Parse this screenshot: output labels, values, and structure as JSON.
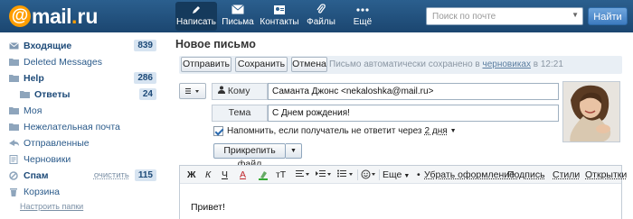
{
  "header": {
    "logo": {
      "at": "@",
      "mail": "mail",
      "dot": ".",
      "ru": "ru"
    },
    "nav": [
      {
        "label": "Написать",
        "icon": "pen-icon",
        "active": true
      },
      {
        "label": "Письма",
        "icon": "envelope-icon",
        "active": false
      },
      {
        "label": "Контакты",
        "icon": "contacts-icon",
        "active": false
      },
      {
        "label": "Файлы",
        "icon": "paperclip-icon",
        "active": false
      },
      {
        "label": "Ещё",
        "icon": "more-dots-icon",
        "active": false
      }
    ],
    "search": {
      "placeholder": "Поиск по почте"
    },
    "find_label": "Найти"
  },
  "sidebar": {
    "folders": [
      {
        "name": "Входящие",
        "icon": "envelope-icon",
        "count": "839",
        "bold": true
      },
      {
        "name": "Deleted Messages",
        "icon": "folder-icon",
        "count": "",
        "bold": false
      },
      {
        "name": "Help",
        "icon": "folder-icon",
        "count": "286",
        "bold": true
      },
      {
        "name": "Ответы",
        "icon": "folder-icon",
        "count": "24",
        "bold": true
      },
      {
        "name": "Моя",
        "icon": "folder-icon",
        "count": "",
        "bold": false
      },
      {
        "name": "Нежелательная почта",
        "icon": "folder-icon",
        "count": "",
        "bold": false
      },
      {
        "name": "Отправленные",
        "icon": "sent-icon",
        "count": "",
        "bold": false
      },
      {
        "name": "Черновики",
        "icon": "draft-icon",
        "count": "",
        "bold": false
      },
      {
        "name": "Спам",
        "icon": "spam-icon",
        "count": "115",
        "bold": true,
        "clear": "очистить"
      },
      {
        "name": "Корзина",
        "icon": "trash-icon",
        "count": "",
        "bold": false
      }
    ],
    "settings_link": "Настроить папки"
  },
  "compose": {
    "title": "Новое письмо",
    "toolbar": {
      "send": "Отправить",
      "save": "Сохранить",
      "cancel": "Отмена",
      "autosave_prefix": "Письмо автоматически сохранено в",
      "autosave_link": "черновиках",
      "autosave_suffix": "в 12:21"
    },
    "to_label": "Кому",
    "to_value": "Саманта Джонс <nekaloshka@mail.ru>",
    "subject_label": "Тема",
    "subject_value": "С Днем рождения!",
    "remind_text": "Напомнить, если получатель не ответит через",
    "remind_value": "2 дня",
    "attach_label": "Прикрепить файл",
    "editor_toolbar": {
      "bold": "Ж",
      "italic": "К",
      "underline": "Ч",
      "font_color": "А",
      "font_size": "тТ",
      "more": "Еще",
      "remove_format": "Убрать оформление",
      "signature": "Подпись",
      "styles": "Стили",
      "cards": "Открытки"
    },
    "body": "Привет!"
  },
  "colors": {
    "header_bg": "#2b5f8e",
    "logo_orange": "#ff9e00",
    "link": "#2a5a8a",
    "badge_bg": "#d7e4f1"
  }
}
